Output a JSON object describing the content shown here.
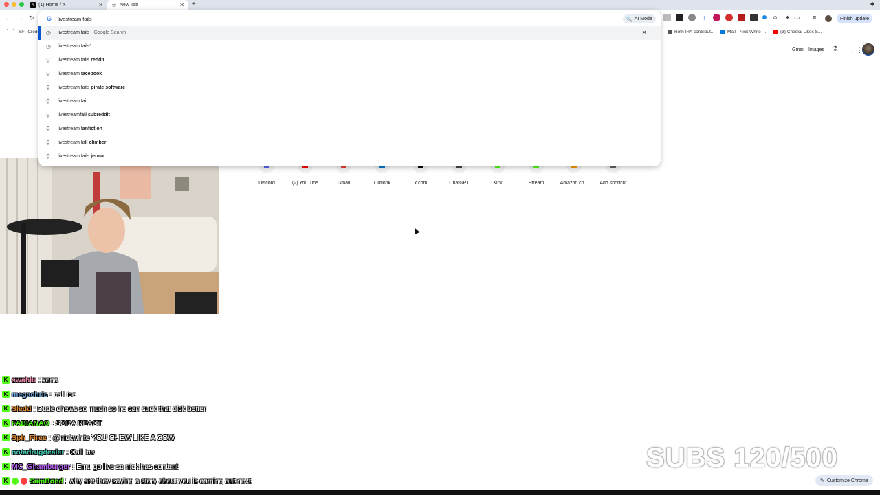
{
  "tabs": [
    {
      "title": "(1) Home / X",
      "active": false
    },
    {
      "title": "New Tab",
      "active": true
    }
  ],
  "omnibox": {
    "value": "livestream fails",
    "ai_mode_label": "AI Mode",
    "suggestions": [
      {
        "prefix": "livestream fails",
        "bold": "",
        "suffix": " - Google Search",
        "icon": "history-icon",
        "selected": true
      },
      {
        "prefix": "livestream fails",
        "bold": "",
        "suffix": "*",
        "icon": "history-icon",
        "selected": false
      },
      {
        "prefix": "livestream fails ",
        "bold": "reddit",
        "suffix": "",
        "icon": "search-icon",
        "selected": false
      },
      {
        "prefix": "livestream f",
        "bold": "acebook",
        "suffix": "",
        "icon": "search-icon",
        "selected": false
      },
      {
        "prefix": "livestream fails ",
        "bold": "pirate software",
        "suffix": "",
        "icon": "search-icon",
        "selected": false
      },
      {
        "prefix": "livestream fai",
        "bold": "",
        "suffix": "",
        "icon": "search-icon",
        "selected": false
      },
      {
        "prefix": "livestream",
        "bold": "fail subreddit",
        "suffix": "",
        "icon": "search-icon",
        "selected": false
      },
      {
        "prefix": "livestream f",
        "bold": "anfiction",
        "suffix": "",
        "icon": "search-icon",
        "selected": false
      },
      {
        "prefix": "livestream fa",
        "bold": "ll climber",
        "suffix": "",
        "icon": "search-icon",
        "selected": false
      },
      {
        "prefix": "livestream fails ",
        "bold": "jerma",
        "suffix": "",
        "icon": "search-icon",
        "selected": false
      }
    ]
  },
  "toolbar": {
    "finish_update": "Finish update"
  },
  "bookmarks": [
    {
      "label": "Crede"
    },
    {
      "label": "Roth IRA contribut..."
    },
    {
      "label": "Mail - Nick White -..."
    },
    {
      "label": "(3) Cheelai Likes S..."
    }
  ],
  "ntp": {
    "gmail": "Gmail",
    "images": "Images",
    "shortcuts": [
      {
        "label": "Discord",
        "color": "#5865f2"
      },
      {
        "label": "(2) YouTube",
        "color": "#ff0000"
      },
      {
        "label": "Gmail",
        "color": "#ea4335"
      },
      {
        "label": "Outlook",
        "color": "#0078d4"
      },
      {
        "label": "x.com",
        "color": "#000000"
      },
      {
        "label": "ChatGPT",
        "color": "#444444"
      },
      {
        "label": "Kick",
        "color": "#53fc18"
      },
      {
        "label": "Stream",
        "color": "#53fc18"
      },
      {
        "label": "Amazon.co...",
        "color": "#ff9900"
      },
      {
        "label": "Add shortcut",
        "color": "#5f6368"
      }
    ],
    "customize_label": "Customize Chrome"
  },
  "chat": [
    {
      "user": "swablu",
      "color": "#e88aa8",
      "msg": "xena",
      "extras": []
    },
    {
      "user": "megachris",
      "color": "#6fa8dc",
      "msg": "call ice",
      "extras": []
    },
    {
      "user": "Sledd",
      "color": "#e69138",
      "msg": "Dude chews so much so he can suck that dick better",
      "extras": []
    },
    {
      "user": "FABIANAO",
      "color": "#53fc18",
      "msg": "SORA REACT",
      "extras": []
    },
    {
      "user": "Sph_Firee",
      "color": "#e69138",
      "msg": "@nickwhite YOU CHEW LIKE A COW",
      "extras": []
    },
    {
      "user": "notadrugdealer",
      "color": "#45c4b0",
      "msg": "Call Ice",
      "extras": []
    },
    {
      "user": "MC_Ghamburger",
      "color": "#b45bf0",
      "msg": "Emu go live so nick has content",
      "extras": []
    },
    {
      "user": "SamBond",
      "color": "#53fc18",
      "msg": "why are they saying a story about you is coming out next",
      "extras": [
        "#53fc18",
        "#ff4040"
      ]
    }
  ],
  "subs": "SUBS 120/500"
}
